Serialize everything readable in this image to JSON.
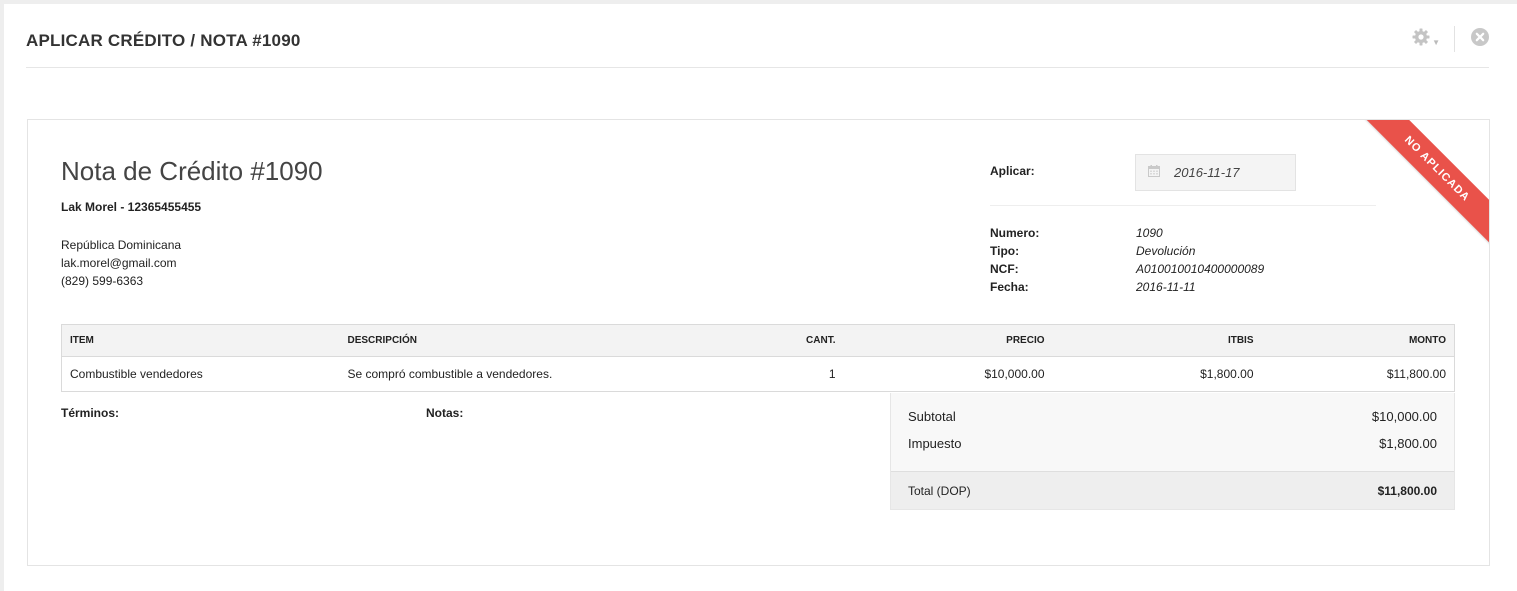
{
  "header": {
    "title": "APLICAR CRÉDITO / NOTA #1090",
    "settings_icon": "gear-icon",
    "close_icon": "close-circle-icon"
  },
  "ribbon": {
    "text": "NO APLICADA",
    "color": "#e9524a"
  },
  "document": {
    "title": "Nota de Crédito #1090",
    "client": "Lak Morel - 12365455455",
    "address_lines": [
      "República Dominicana",
      "lak.morel@gmail.com",
      "(829) 599-6363"
    ]
  },
  "apply": {
    "label": "Aplicar:",
    "date_icon": "calendar-icon",
    "date_value": "2016-11-17"
  },
  "meta": [
    {
      "key": "Numero:",
      "value": "1090"
    },
    {
      "key": "Tipo:",
      "value": "Devolución"
    },
    {
      "key": "NCF:",
      "value": "A010010010400000089"
    },
    {
      "key": "Fecha:",
      "value": "2016-11-11"
    }
  ],
  "table": {
    "headers": [
      "ITEM",
      "DESCRIPCIÓN",
      "CANT.",
      "PRECIO",
      "ITBIS",
      "MONTO"
    ],
    "rows": [
      [
        "Combustible vendedores",
        "Se compró combustible a vendedores.",
        "1",
        "$10,000.00",
        "$1,800.00",
        "$11,800.00"
      ]
    ]
  },
  "footer": {
    "terms_label": "Términos:",
    "notes_label": "Notas:"
  },
  "totals": {
    "subtotal_label": "Subtotal",
    "subtotal": "$10,000.00",
    "tax_label": "Impuesto",
    "tax": "$1,800.00",
    "total_label": "Total (DOP)",
    "total": "$11,800.00"
  }
}
